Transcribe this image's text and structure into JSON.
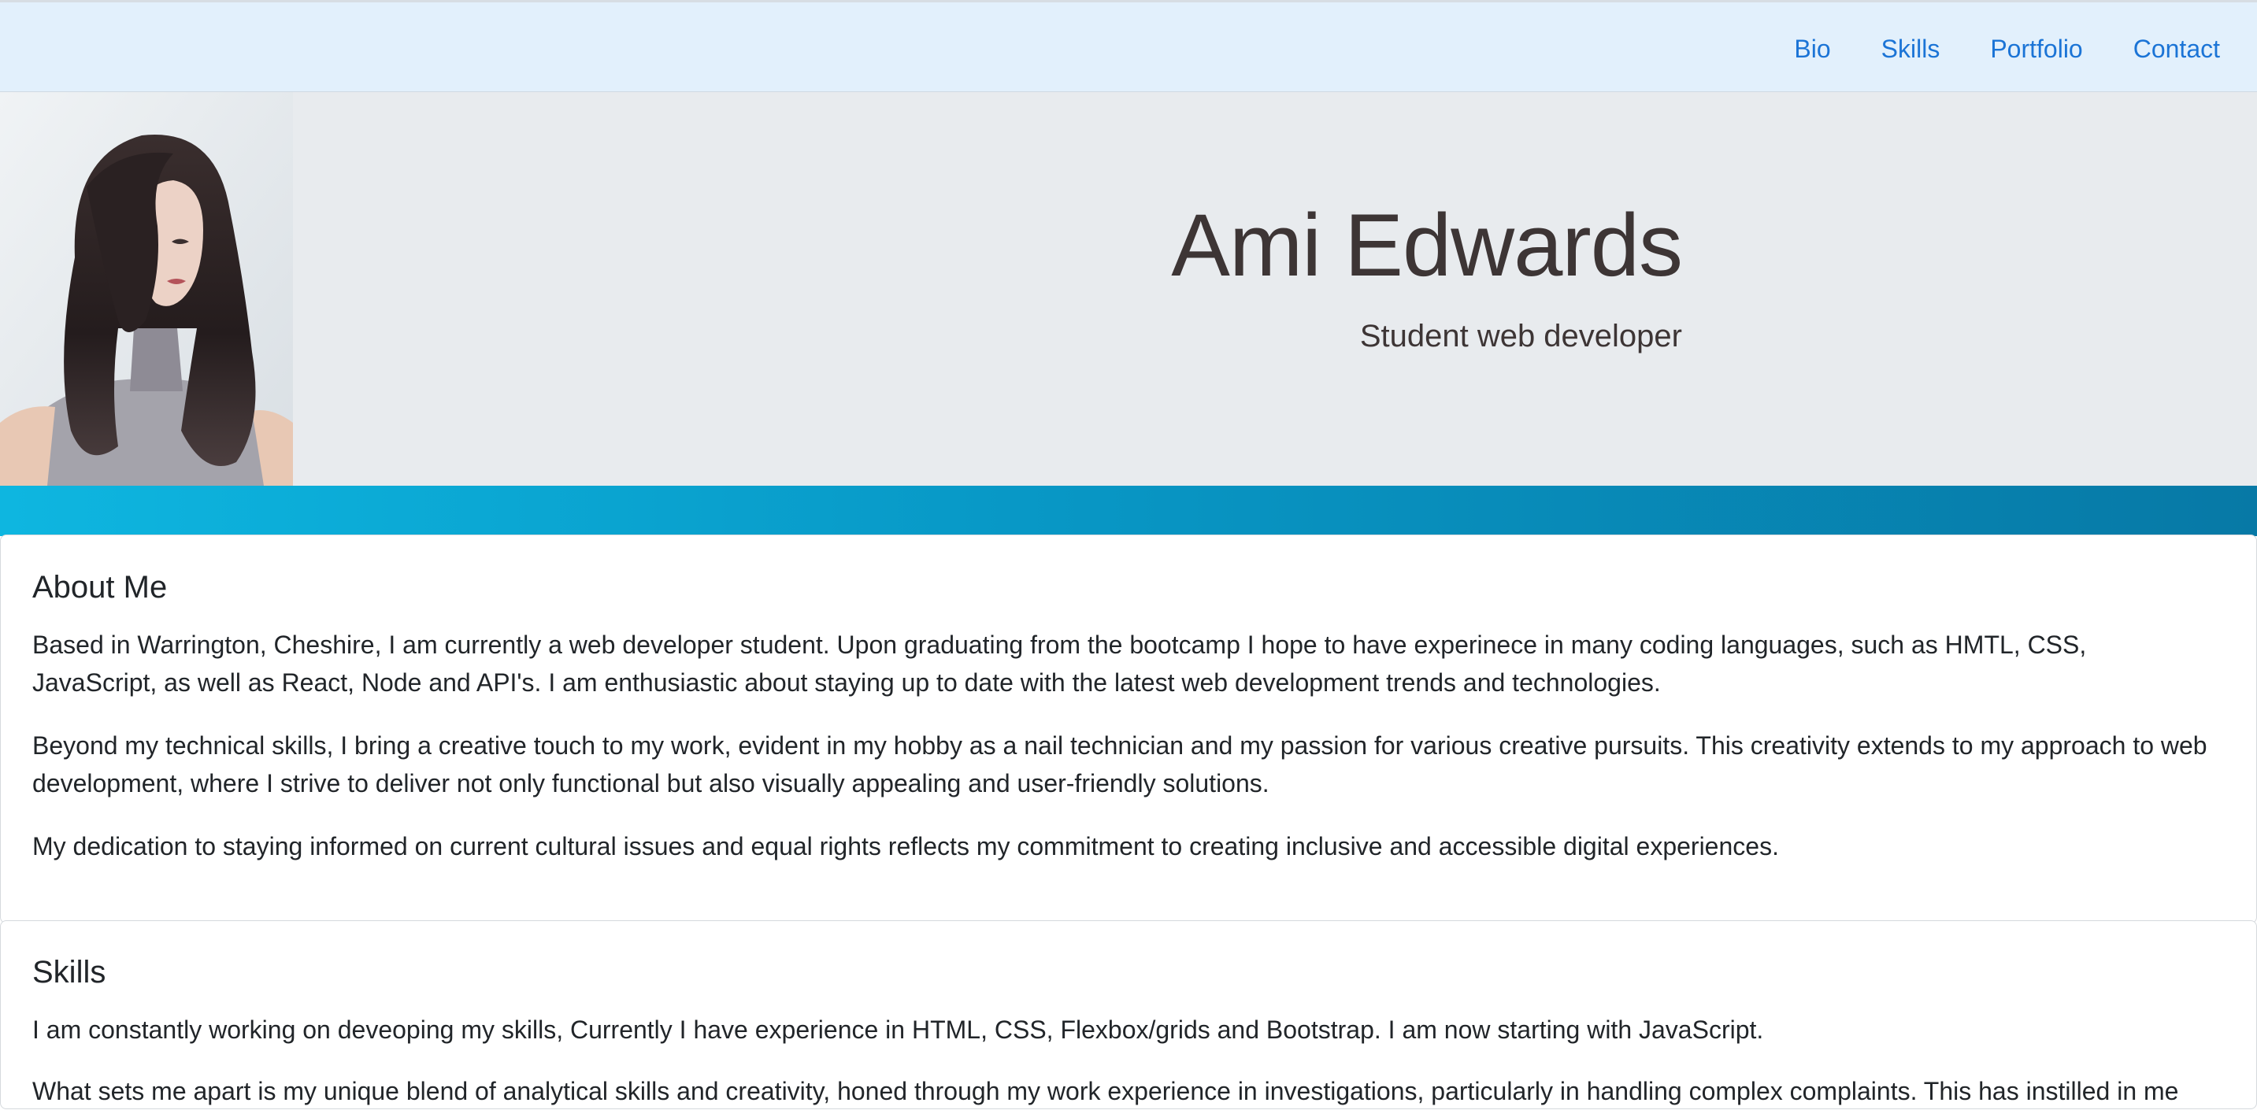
{
  "nav": {
    "links": [
      "Bio",
      "Skills",
      "Portfolio",
      "Contact"
    ]
  },
  "hero": {
    "name": "Ami Edwards",
    "tagline": "Student web developer",
    "portrait_alt": "portrait photo"
  },
  "about": {
    "title": "About Me",
    "paragraphs": [
      "Based in Warrington, Cheshire, I am currently a web developer student. Upon graduating from the bootcamp I hope to have experinece in many coding languages, such as HMTL, CSS, JavaScript, as well as React, Node and API's. I am enthusiastic about staying up to date with the latest web development trends and technologies.",
      "Beyond my technical skills, I bring a creative touch to my work, evident in my hobby as a nail technician and my passion for various creative pursuits. This creativity extends to my approach to web development, where I strive to deliver not only functional but also visually appealing and user-friendly solutions.",
      "My dedication to staying informed on current cultural issues and equal rights reflects my commitment to creating inclusive and accessible digital experiences."
    ]
  },
  "skills": {
    "title": "Skills",
    "paragraphs": [
      "I am constantly working on deveoping my skills, Currently I have experience in HTML, CSS, Flexbox/grids and Bootstrap. I am now starting with JavaScript.",
      "What sets me apart is my unique blend of analytical skills and creativity, honed through my work experience in investigations, particularly in handling complex complaints. This has instilled in me"
    ]
  },
  "colors": {
    "nav_bg": "#e2f0fc",
    "nav_link": "#1b74d6",
    "hero_bg": "#e8ebee",
    "band_start": "#0eb6e0",
    "band_end": "#0779a6"
  }
}
